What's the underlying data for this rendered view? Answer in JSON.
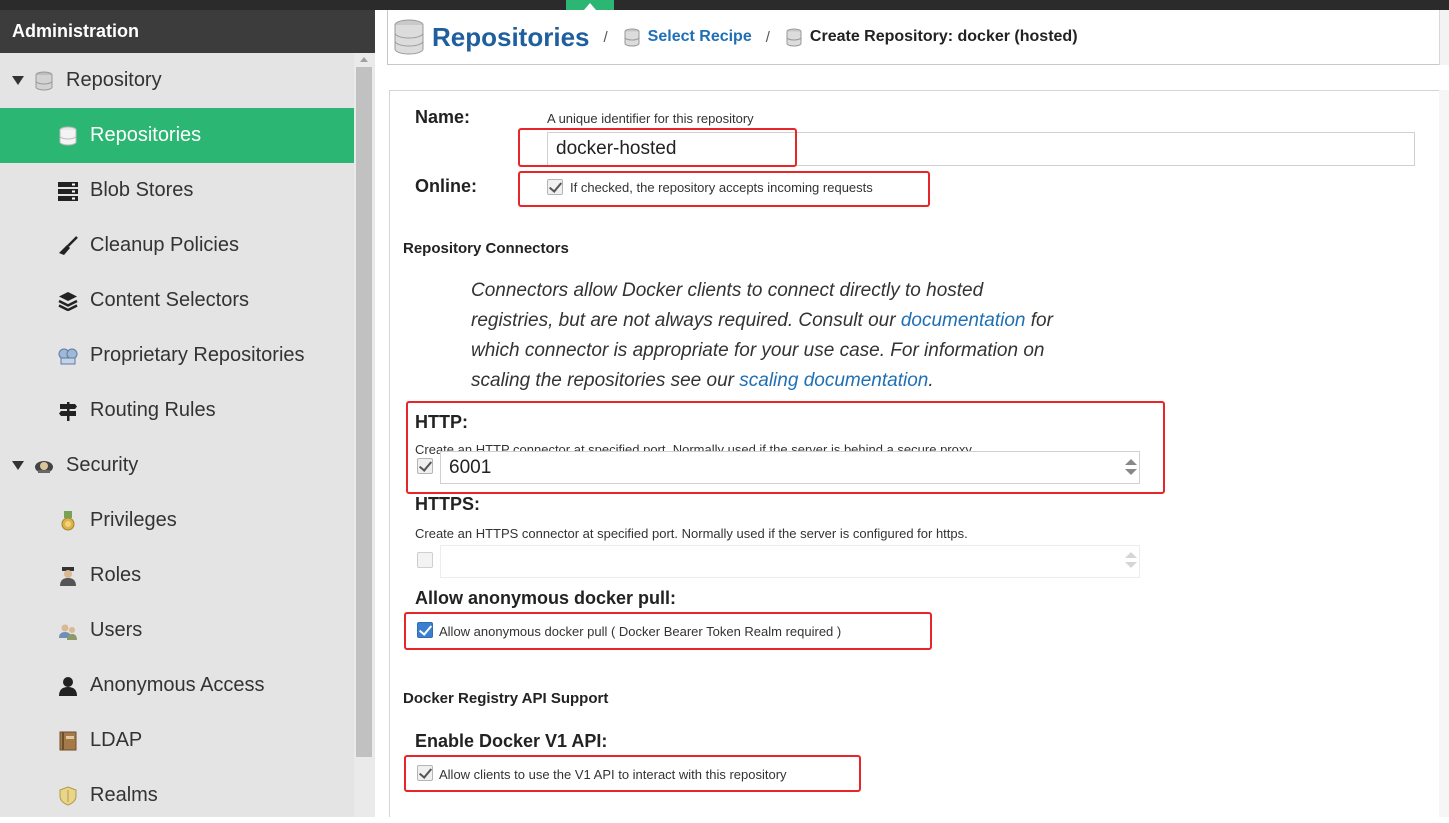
{
  "sidebar": {
    "header": "Administration",
    "groups": [
      {
        "label": "Repository",
        "icon": "database-icon"
      },
      {
        "label": "Security",
        "icon": "security-icon"
      }
    ],
    "items": [
      {
        "label": "Repositories",
        "icon": "database-icon",
        "selected": true
      },
      {
        "label": "Blob Stores",
        "icon": "server-icon"
      },
      {
        "label": "Cleanup Policies",
        "icon": "broom-icon"
      },
      {
        "label": "Content Selectors",
        "icon": "layers-icon"
      },
      {
        "label": "Proprietary Repositories",
        "icon": "proprietary-icon"
      },
      {
        "label": "Routing Rules",
        "icon": "signpost-icon"
      },
      {
        "label": "Privileges",
        "icon": "medal-icon"
      },
      {
        "label": "Roles",
        "icon": "role-icon"
      },
      {
        "label": "Users",
        "icon": "users-icon"
      },
      {
        "label": "Anonymous Access",
        "icon": "user-icon"
      },
      {
        "label": "LDAP",
        "icon": "book-icon"
      },
      {
        "label": "Realms",
        "icon": "shield-icon"
      }
    ]
  },
  "breadcrumb": {
    "title": "Repositories",
    "separator": "/",
    "link": "Select Recipe",
    "current": "Create Repository: docker (hosted)"
  },
  "form": {
    "name": {
      "label": "Name:",
      "help": "A unique identifier for this repository",
      "value": "docker-hosted"
    },
    "online": {
      "label": "Online:",
      "checked": true,
      "text": "If checked, the repository accepts incoming requests"
    },
    "connectors": {
      "title": "Repository Connectors",
      "description_1": "Connectors allow Docker clients to connect directly to hosted",
      "description_2a": "registries, but are not always required. Consult our ",
      "description_2_link": "documentation",
      "description_2b": " for",
      "description_3": "which connector is appropriate for your use case. For information on",
      "description_4a": "scaling the repositories see our ",
      "description_4_link": "scaling documentation",
      "description_4b": "."
    },
    "http": {
      "label": "HTTP:",
      "help": "Create an HTTP connector at specified port. Normally used if the server is behind a secure proxy.",
      "checked": true,
      "value": "6001"
    },
    "https": {
      "label": "HTTPS:",
      "help": "Create an HTTPS connector at specified port. Normally used if the server is configured for https.",
      "checked": false,
      "value": ""
    },
    "anonymous_pull": {
      "label": "Allow anonymous docker pull:",
      "checked": true,
      "text": "Allow anonymous docker pull ( Docker Bearer Token Realm required )"
    },
    "api_support": {
      "title": "Docker Registry API Support"
    },
    "v1_api": {
      "label": "Enable Docker V1 API:",
      "checked": true,
      "text": "Allow clients to use the V1 API to interact with this repository"
    }
  },
  "colors": {
    "accent": "#2bb673",
    "link": "#1f6fb5",
    "highlight": "#e8262a"
  }
}
